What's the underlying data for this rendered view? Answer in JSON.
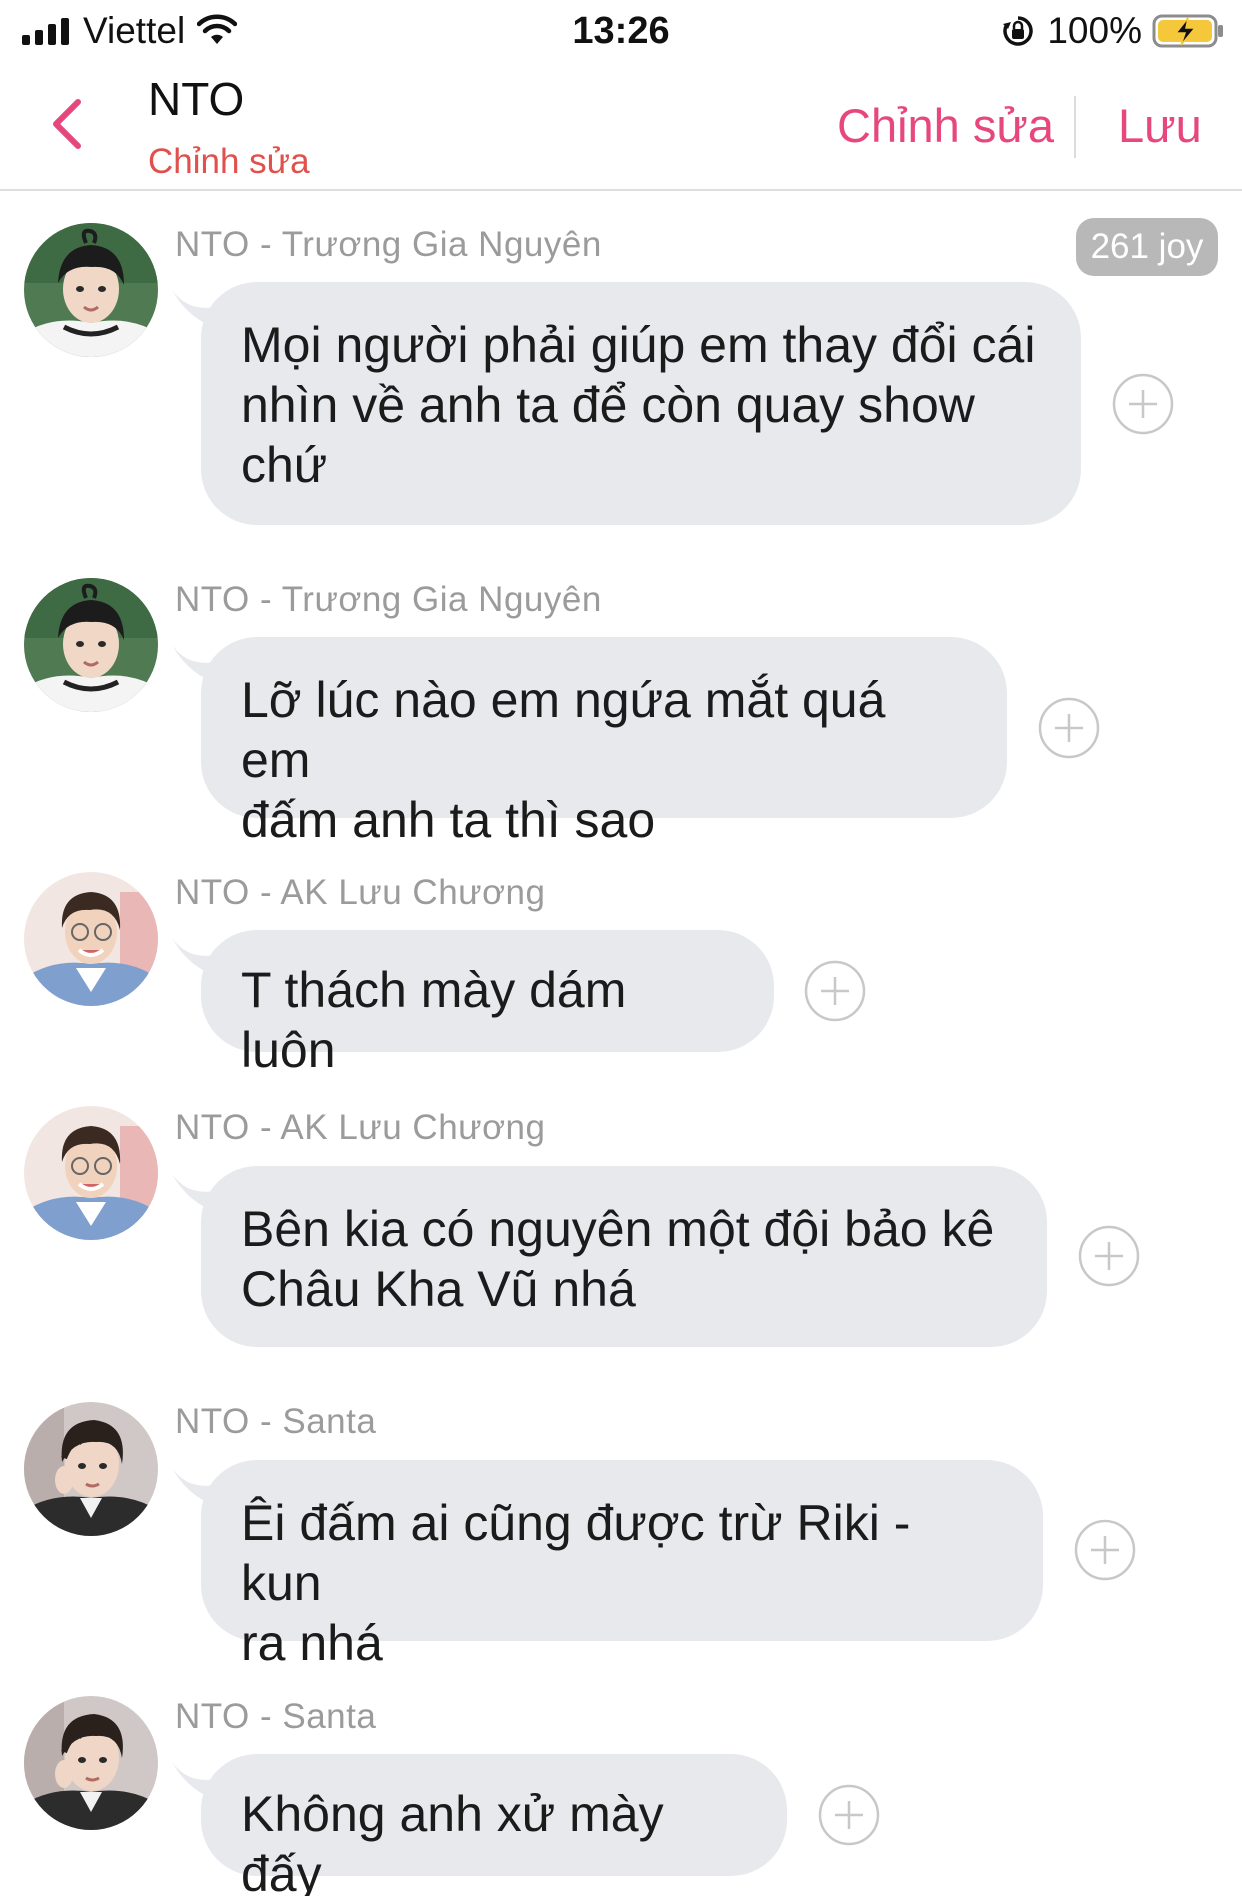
{
  "status_bar": {
    "carrier": "Viettel",
    "time": "13:26",
    "battery_percent": "100%"
  },
  "nav": {
    "title": "NTO",
    "subtitle": "Chỉnh sửa",
    "edit_label": "Chỉnh sửa",
    "save_label": "Lưu"
  },
  "colors": {
    "accent": "#e6487e",
    "subtitle": "#e0504c",
    "bubble": "#e8e9ed",
    "sender": "#9b9b9b"
  },
  "joy_badge": "261 joy",
  "messages": [
    {
      "sender": "NTO - Trương Gia Nguyên",
      "lines": [
        "Mọi người phải giúp em thay đổi cái",
        "nhìn về anh ta để còn quay show",
        "chứ"
      ],
      "avatar": "avatar-truong-gia-nguyen"
    },
    {
      "sender": "NTO - Trương Gia Nguyên",
      "lines": [
        "Lỡ lúc nào em ngứa mắt quá em",
        "đấm anh ta thì sao"
      ],
      "avatar": "avatar-truong-gia-nguyen"
    },
    {
      "sender": "NTO - AK Lưu Chương",
      "lines": [
        "T thách mày dám luôn"
      ],
      "avatar": "avatar-ak-luu-chuong"
    },
    {
      "sender": "NTO - AK Lưu Chương",
      "lines": [
        "Bên kia có nguyên một đội bảo kê",
        "Châu Kha Vũ nhá"
      ],
      "avatar": "avatar-ak-luu-chuong"
    },
    {
      "sender": "NTO - Santa",
      "lines": [
        "Êi đấm ai cũng được trừ Riki - kun",
        "ra nhá"
      ],
      "avatar": "avatar-santa"
    },
    {
      "sender": "NTO - Santa",
      "lines": [
        "Không anh xử mày đấy"
      ],
      "avatar": "avatar-santa"
    }
  ]
}
